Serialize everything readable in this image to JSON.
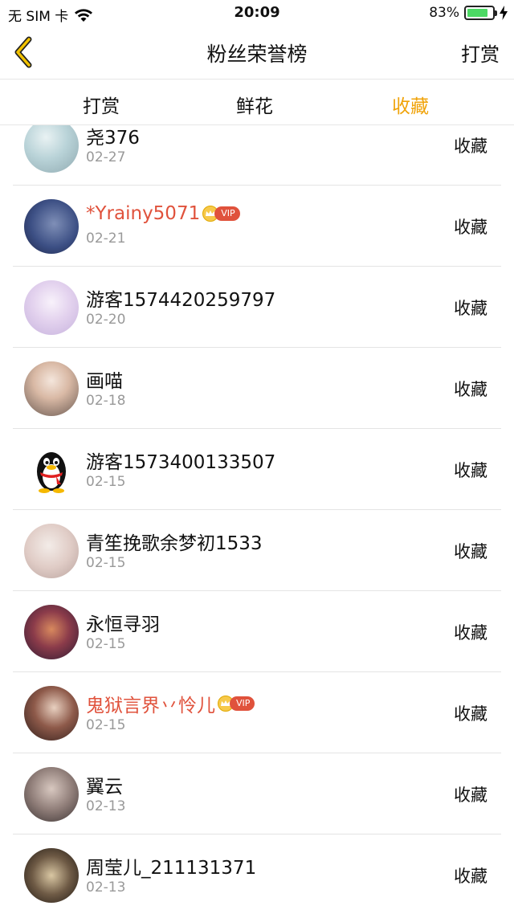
{
  "status_bar": {
    "carrier": "无 SIM 卡",
    "time": "20:09",
    "battery_text": "83%",
    "battery_level": 0.83
  },
  "nav": {
    "title": "粉丝荣誉榜",
    "right_action": "打赏",
    "accent_color": "#f0a30a"
  },
  "tabs": [
    {
      "label": "打赏",
      "active": false
    },
    {
      "label": "鲜花",
      "active": false
    },
    {
      "label": "收藏",
      "active": true
    }
  ],
  "list": {
    "vip_label": "VIP",
    "items": [
      {
        "name": "尧376",
        "date": "02-27",
        "action": "收藏",
        "vip": false
      },
      {
        "name": "*Yrainy5071",
        "date": "02-21",
        "action": "收藏",
        "vip": true
      },
      {
        "name": "游客1574420259797",
        "date": "02-20",
        "action": "收藏",
        "vip": false
      },
      {
        "name": "画喵",
        "date": "02-18",
        "action": "收藏",
        "vip": false
      },
      {
        "name": "游客1573400133507",
        "date": "02-15",
        "action": "收藏",
        "vip": false
      },
      {
        "name": "青笙挽歌余梦初1533",
        "date": "02-15",
        "action": "收藏",
        "vip": false
      },
      {
        "name": "永恒寻羽",
        "date": "02-15",
        "action": "收藏",
        "vip": false
      },
      {
        "name": "鬼狱言界丷怜儿",
        "date": "02-15",
        "action": "收藏",
        "vip": true
      },
      {
        "name": "翼云",
        "date": "02-13",
        "action": "收藏",
        "vip": false
      },
      {
        "name": "周莹儿_211131371",
        "date": "02-13",
        "action": "收藏",
        "vip": false
      }
    ]
  }
}
